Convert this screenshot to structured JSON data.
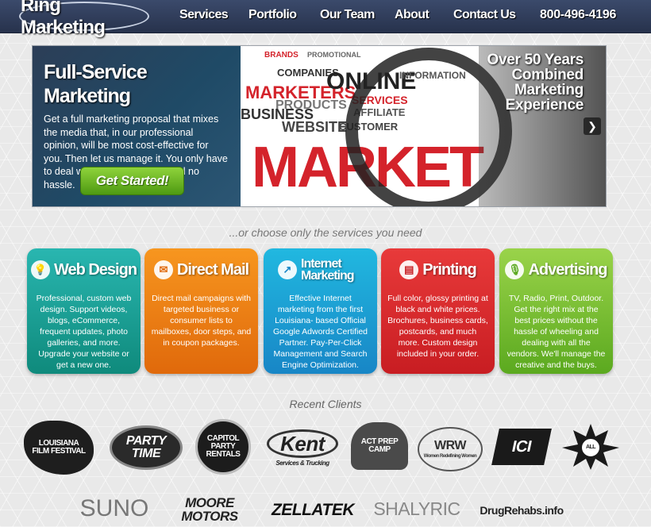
{
  "nav": {
    "logo": "Ring Marketing",
    "links": [
      "Services",
      "Portfolio",
      "Our Team",
      "About",
      "Contact Us"
    ],
    "phone": "800-496-4196"
  },
  "hero": {
    "title": "Full-Service Marketing",
    "text": "Get a full marketing proposal that mixes the media that, in our professional opinion, will be most cost-effective for you. Then let us manage it. You only have to deal with one vendor (us) and no hassle.",
    "button": "Get Started!",
    "caption_lines": [
      "Over 50 Years",
      "Combined",
      "Marketing",
      "Experience"
    ],
    "next_icon": "chevron-right-icon",
    "collage_words": [
      "MARKETERS",
      "COMPANIES",
      "ONLINE",
      "SERVICES",
      "AFFILIATE",
      "WEBSITE",
      "CUSTOMER",
      "BUSINESS",
      "MARKET",
      "PRODUCTS",
      "PROMOTIONAL",
      "INFORMATION",
      "BRANDS"
    ]
  },
  "tagline": "...or choose only the services you need",
  "services": [
    {
      "title": "Web Design",
      "icon": "lightbulb-icon",
      "text": "Professional, custom web design. Support videos, blogs, eCommerce, frequent updates, photo galleries, and more. Upgrade your website or get a new one."
    },
    {
      "title": "Direct Mail",
      "icon": "envelope-icon",
      "text": "Direct mail campaigns with targeted business or consumer lists to mailboxes, door steps, and in coupon packages."
    },
    {
      "title": "Internet Marketing",
      "icon": "chart-icon",
      "text": "Effective Internet marketing from the first Louisiana- based Official Google Adwords Certified Partner. Pay-Per-Click Management and Search Engine Optimization."
    },
    {
      "title": "Printing",
      "icon": "printer-icon",
      "text": "Full color, glossy printing at black and white prices. Brochures, business cards, postcards, and much more. Custom design included in your order."
    },
    {
      "title": "Advertising",
      "icon": "microphone-icon",
      "text": "TV, Radio, Print, Outdoor. Get the right mix at the best prices without the hassle of wheeling and dealing with all the vendors. We'll manage the creative and the buys."
    }
  ],
  "clients_title": "Recent Clients",
  "clients_row1": [
    {
      "name": "LOUISIANA FILM FESTIVAL"
    },
    {
      "name": "PARTY TIME"
    },
    {
      "name": "CAPITOL PARTY RENTALS"
    },
    {
      "name": "Kent",
      "sub": "Services & Trucking"
    },
    {
      "name": "ACT PREP CAMP"
    },
    {
      "name": "WRW",
      "sub": "Women Redefining Women"
    },
    {
      "name": "ICI"
    },
    {
      "name": "ALL"
    }
  ],
  "clients_row2": [
    {
      "name": "SUNO"
    },
    {
      "name": "MOORE MOTORS"
    },
    {
      "name": "ZELLATEK"
    },
    {
      "name": "SHALYRIC"
    },
    {
      "name": "DrugRehabs.info"
    }
  ]
}
